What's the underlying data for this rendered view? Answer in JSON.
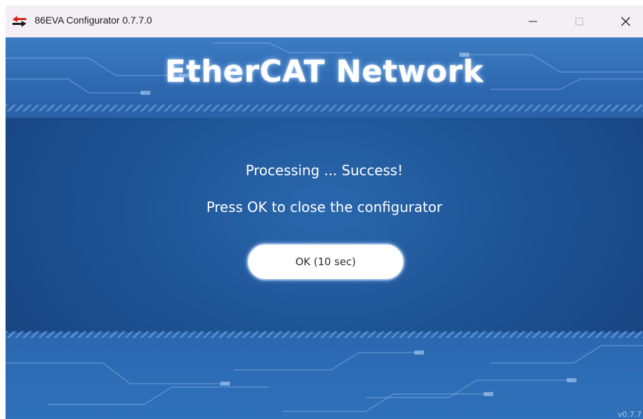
{
  "window": {
    "title": "86EVA Configurator 0.7.7.0",
    "icon": "red-black-arrows-icon",
    "controls": [
      "minimize",
      "maximize",
      "close"
    ]
  },
  "header": {
    "title": "EtherCAT Network"
  },
  "main": {
    "status_line_1": "Processing ... Success!",
    "status_line_2": "Press OK to close the configurator",
    "ok_button_label": "OK (10 sec)"
  },
  "footer": {
    "version": "v0.7.7"
  },
  "colors": {
    "background": "#1e4f8c",
    "accent_band": "#3d7cc2",
    "button_bg": "#ffffff",
    "titlebar_bg": "#f4eff4"
  }
}
